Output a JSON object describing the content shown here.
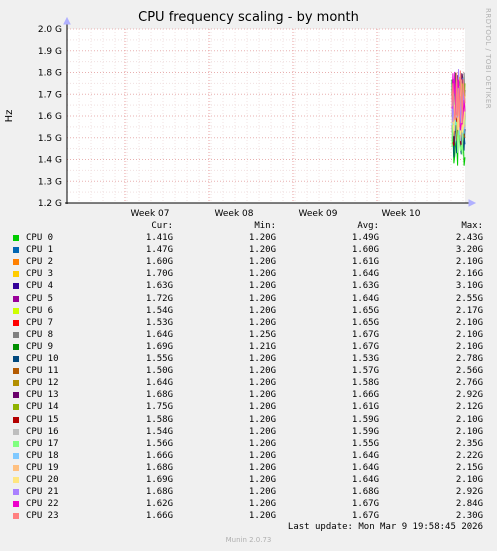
{
  "chart_data": {
    "type": "line",
    "title": "CPU frequency scaling - by month",
    "ylabel": "Hz",
    "ylim": [
      1.2,
      2.0
    ],
    "y_ticks": [
      "1.2 G",
      "1.3 G",
      "1.4 G",
      "1.5 G",
      "1.6 G",
      "1.7 G",
      "1.8 G",
      "1.9 G",
      "2.0 G"
    ],
    "x_ticks": [
      "Week 07",
      "Week 08",
      "Week 09",
      "Week 10"
    ],
    "grid": true,
    "legend_headers": {
      "cur": "Cur:",
      "min": "Min:",
      "avg": "Avg:",
      "max": "Max:"
    },
    "series": [
      {
        "name": "CPU 0",
        "color": "#00cc00",
        "cur": "1.41G",
        "min": "1.20G",
        "avg": "1.49G",
        "max": "2.43G"
      },
      {
        "name": "CPU 1",
        "color": "#0066b3",
        "cur": "1.47G",
        "min": "1.20G",
        "avg": "1.60G",
        "max": "3.20G"
      },
      {
        "name": "CPU 2",
        "color": "#ff8000",
        "cur": "1.60G",
        "min": "1.20G",
        "avg": "1.61G",
        "max": "2.10G"
      },
      {
        "name": "CPU 3",
        "color": "#ffcc00",
        "cur": "1.70G",
        "min": "1.20G",
        "avg": "1.64G",
        "max": "2.16G"
      },
      {
        "name": "CPU 4",
        "color": "#330099",
        "cur": "1.63G",
        "min": "1.20G",
        "avg": "1.63G",
        "max": "3.10G"
      },
      {
        "name": "CPU 5",
        "color": "#990099",
        "cur": "1.72G",
        "min": "1.20G",
        "avg": "1.64G",
        "max": "2.55G"
      },
      {
        "name": "CPU 6",
        "color": "#ccff00",
        "cur": "1.54G",
        "min": "1.20G",
        "avg": "1.65G",
        "max": "2.17G"
      },
      {
        "name": "CPU 7",
        "color": "#ff0000",
        "cur": "1.53G",
        "min": "1.20G",
        "avg": "1.65G",
        "max": "2.10G"
      },
      {
        "name": "CPU 8",
        "color": "#808080",
        "cur": "1.64G",
        "min": "1.25G",
        "avg": "1.67G",
        "max": "2.10G"
      },
      {
        "name": "CPU 9",
        "color": "#008f00",
        "cur": "1.69G",
        "min": "1.21G",
        "avg": "1.67G",
        "max": "2.10G"
      },
      {
        "name": "CPU 10",
        "color": "#00487d",
        "cur": "1.55G",
        "min": "1.20G",
        "avg": "1.53G",
        "max": "2.78G"
      },
      {
        "name": "CPU 11",
        "color": "#b35a00",
        "cur": "1.50G",
        "min": "1.20G",
        "avg": "1.57G",
        "max": "2.56G"
      },
      {
        "name": "CPU 12",
        "color": "#b38f00",
        "cur": "1.64G",
        "min": "1.20G",
        "avg": "1.58G",
        "max": "2.76G"
      },
      {
        "name": "CPU 13",
        "color": "#6b006b",
        "cur": "1.68G",
        "min": "1.20G",
        "avg": "1.66G",
        "max": "2.92G"
      },
      {
        "name": "CPU 14",
        "color": "#8fb300",
        "cur": "1.75G",
        "min": "1.20G",
        "avg": "1.61G",
        "max": "2.12G"
      },
      {
        "name": "CPU 15",
        "color": "#b30000",
        "cur": "1.58G",
        "min": "1.20G",
        "avg": "1.59G",
        "max": "2.10G"
      },
      {
        "name": "CPU 16",
        "color": "#bebebe",
        "cur": "1.54G",
        "min": "1.20G",
        "avg": "1.59G",
        "max": "2.10G"
      },
      {
        "name": "CPU 17",
        "color": "#80ff80",
        "cur": "1.56G",
        "min": "1.20G",
        "avg": "1.55G",
        "max": "2.35G"
      },
      {
        "name": "CPU 18",
        "color": "#80c9ff",
        "cur": "1.66G",
        "min": "1.20G",
        "avg": "1.64G",
        "max": "2.22G"
      },
      {
        "name": "CPU 19",
        "color": "#ffc080",
        "cur": "1.68G",
        "min": "1.20G",
        "avg": "1.64G",
        "max": "2.15G"
      },
      {
        "name": "CPU 20",
        "color": "#ffe680",
        "cur": "1.69G",
        "min": "1.20G",
        "avg": "1.64G",
        "max": "2.10G"
      },
      {
        "name": "CPU 21",
        "color": "#aa80ff",
        "cur": "1.68G",
        "min": "1.20G",
        "avg": "1.68G",
        "max": "2.92G"
      },
      {
        "name": "CPU 22",
        "color": "#ee00cc",
        "cur": "1.62G",
        "min": "1.20G",
        "avg": "1.67G",
        "max": "2.84G"
      },
      {
        "name": "CPU 23",
        "color": "#ff8080",
        "cur": "1.66G",
        "min": "1.20G",
        "avg": "1.67G",
        "max": "2.30G"
      }
    ]
  },
  "footer": {
    "last_update": "Last update: Mon Mar  9 19:58:45 2026",
    "version": "Munin 2.0.73"
  },
  "watermark": "RRDTOOL / TOBI OETIKER"
}
